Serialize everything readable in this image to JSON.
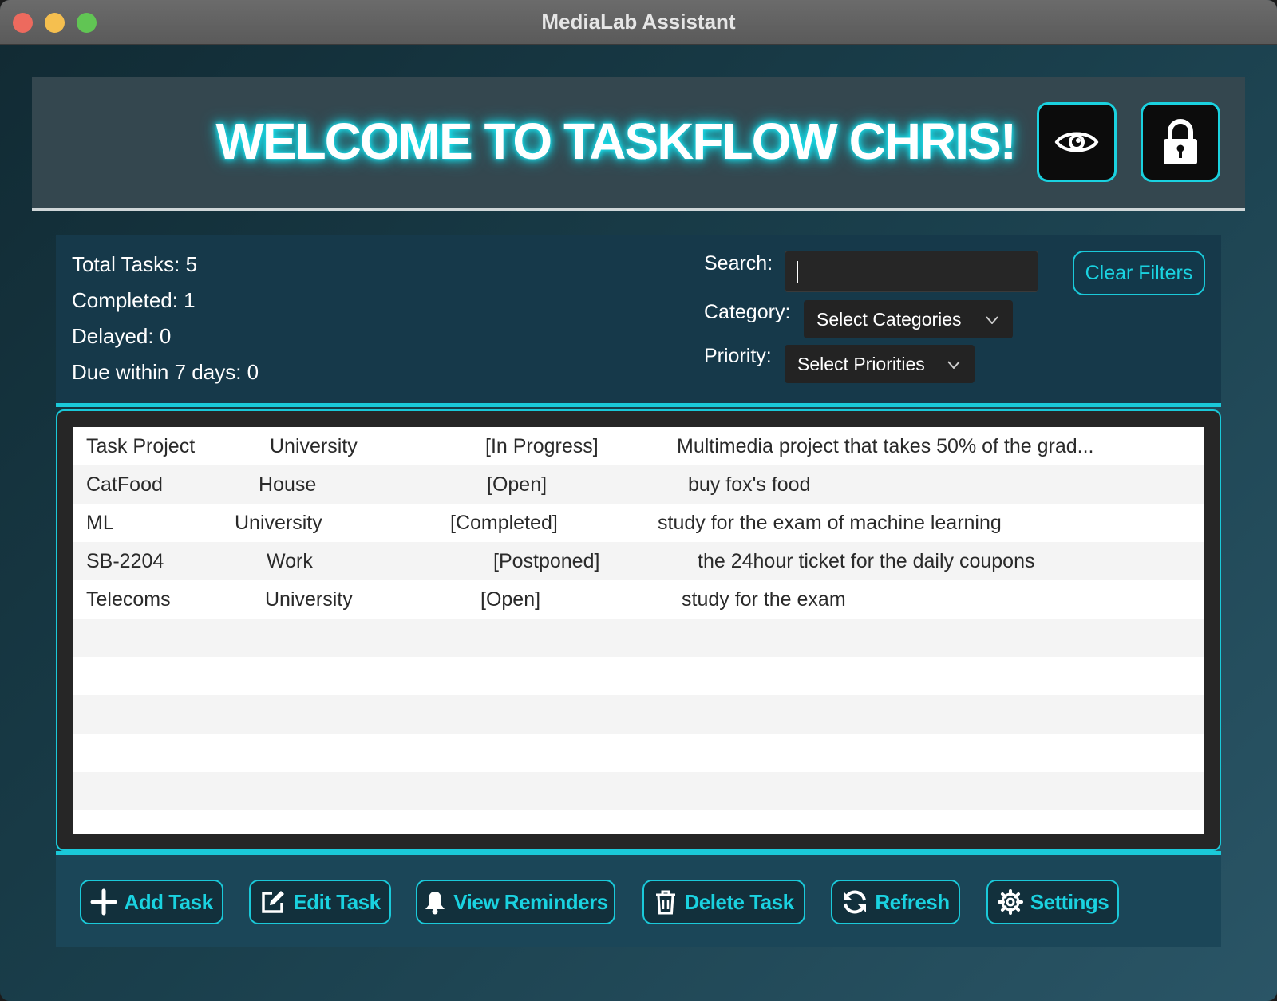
{
  "window": {
    "title": "MediaLab Assistant"
  },
  "header": {
    "welcome": "WELCOME TO TASKFLOW CHRIS!",
    "buttons": [
      "eye-icon",
      "lock-icon"
    ]
  },
  "stats": {
    "total": "Total Tasks: 5",
    "completed": "Completed: 1",
    "delayed": "Delayed: 0",
    "due_soon": "Due within 7 days: 0"
  },
  "filters": {
    "search_label": "Search:",
    "search_value": "",
    "category_label": "Category:",
    "category_value": "Select Categories",
    "priority_label": "Priority:",
    "priority_value": "Select Priorities",
    "clear_label": "Clear Filters"
  },
  "tasks": [
    {
      "name": "Task Project",
      "category": "University",
      "status": "[In Progress]",
      "description": "Multimedia project that takes 50% of the grad..."
    },
    {
      "name": "CatFood",
      "category": "House",
      "status": "[Open]",
      "description": "buy fox's food"
    },
    {
      "name": "ML",
      "category": "University",
      "status": "[Completed]",
      "description": "study for the exam of machine learning"
    },
    {
      "name": "SB-2204",
      "category": "Work",
      "status": "[Postponed]",
      "description": "the 24hour ticket for the daily coupons"
    },
    {
      "name": "Telecoms",
      "category": "University",
      "status": "[Open]",
      "description": "study for the exam"
    }
  ],
  "actions": {
    "add": "Add Task",
    "edit": "Edit Task",
    "reminders": "View Reminders",
    "delete": "Delete Task",
    "refresh": "Refresh",
    "settings": "Settings"
  },
  "colors": {
    "accent": "#1ad2e0",
    "glow": "#19e3f0",
    "panel": "#16394a",
    "footer": "#1b4658"
  }
}
